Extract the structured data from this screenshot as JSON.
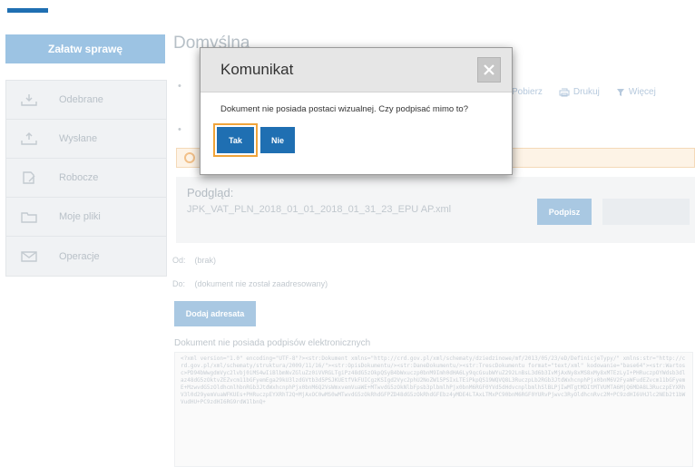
{
  "sidebar": {
    "cta_label": "Załatw sprawę",
    "items": [
      {
        "label": "Odebrane",
        "icon": "inbox-download-icon"
      },
      {
        "label": "Wysłane",
        "icon": "outbox-upload-icon"
      },
      {
        "label": "Robocze",
        "icon": "draft-document-icon"
      },
      {
        "label": "Moje pliki",
        "icon": "folder-icon"
      },
      {
        "label": "Operacje",
        "icon": "operations-icon"
      }
    ]
  },
  "main": {
    "title": "Domyślna",
    "toolbar": {
      "download": "Pobierz",
      "print": "Drukuj",
      "more": "Więcej"
    },
    "preview_label": "Podgląd:",
    "preview_file": "JPK_VAT_PLN_2018_01_01_2018_01_31_23_EPU AP.xml",
    "sign_button": "Podpisz",
    "from_label": "Od:",
    "from_value": "(brak)",
    "to_label": "Do:",
    "to_value": "(dokument nie został zaadresowany)",
    "add_attachment": "Dodaj adresata",
    "no_signature": "Dokument nie posiada podpisów elektronicznych",
    "xml_preview": "<?xml version=\"1.0\" encoding=\"UTF-8\"?><str:Dokument xmlns=\"http://crd.gov.pl/xml/schematy/dziedzinowe/mf/2013/05/23/eD/DefinicjeTypy/\" xmlns:str=\"http://crd.gov.pl/xml/schematy/struktura/2009/11/16/\"><str:OpisDokumentu/><str:DaneDokumentu/><str:TrescDokumentu format=\"text/xml\" kodowanie=\"base64\"><str:Wartosc>PD94bWwgdmVyc2lvbj0iMS4wIiBlbmNvZGluZz0iVVRGLTgiPz48dG5zOkpQSyB4bWxuczp0bnM9Imh0dHA6Ly9qcGsubWYuZ292LnBsL3d6b3IvMjAxNy8xMS8xMy8xMTEzLyI+PHRuczpOYWdsb3dlaz48dG5zOktvZEZvcm11bGFyemEga29kU3lzdGVtb3d5PSJKUEtfVkFUICgzKSIgd2Vyc2phU2NoZW15PSIxLTEiPkpQS19WQVQ8L3RuczpLb2RGb3JtdWxhcnphPjx0bnM6V2FyaWFudEZvcm11bGFyemE+MzwvdG5zOldhcmlhbnRGb3JtdWxhcnphPjx0bnM6Q2VsWmxvemVuaWE+MTwvdG5zOkNlbFpsb3plbmlhPjx0bnM6RGF0YVd5dHdvcnplbmlhSlBLPjIwMTgtMDItMTVUMTA6MjQ6MDA8L3RuczpEYXRhV3l0d29yemVuaWFKUEs+PHRuczpEYXRhT2Q+MjAxOC0wMS0wMTwvdG5zOkRhdGFPZD48dG5zOkRhdGFEbz4yMDE4LTAxLTMxPC90bnM6RGF0YURvPjwvc3RyOldhcnRvc2M+PC9zdHI6VHJlc2NEb2t1bWVudHU+PC9zdHI6RG9rdW1lbnQ+"
  },
  "modal": {
    "title": "Komunikat",
    "close": "×",
    "message": "Dokument nie posiada postaci wizualnej. Czy podpisać mimo to?",
    "yes": "Tak",
    "no": "Nie"
  }
}
